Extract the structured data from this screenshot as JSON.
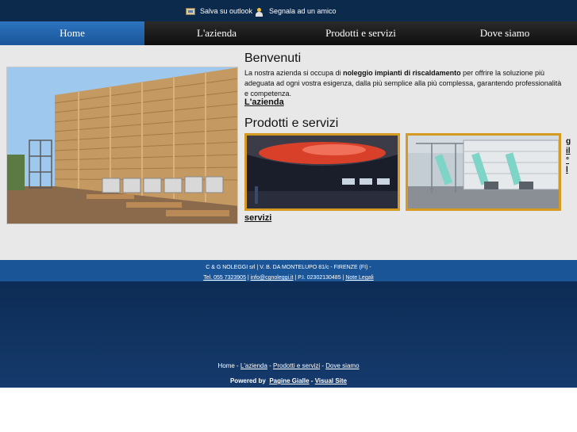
{
  "topbar": {
    "outlook_label": "Salva su outlook",
    "friend_label": "Segnala ad un amico"
  },
  "nav": {
    "items": [
      {
        "label": "Home",
        "active": true
      },
      {
        "label": "L'azienda",
        "active": false
      },
      {
        "label": "Prodotti e servizi",
        "active": false
      },
      {
        "label": "Dove siamo",
        "active": false
      }
    ]
  },
  "welcome": {
    "title": "Benvenuti",
    "text_before": "La nostra azienda si occupa di ",
    "text_bold": "noleggio impianti di riscaldamento",
    "text_after": " per offrire la soluzione più adeguata ad ogni vostra esigenza, dalla più semplice alla più complessa, garantendo professionalità e competenza.",
    "link": "L'azienda"
  },
  "products": {
    "title": "Prodotti e servizi",
    "link": "servizi",
    "edge_fragment": "g\nil\n°\nl"
  },
  "footer": {
    "company": "C & G NOLEGGI srl | V. B. DA MONTELUPO 81/c - FIRENZE (FI) -",
    "phone": "Tel. 055 7323905",
    "email": "info@cgnoleggi.it",
    "vat": "P.I. 02302130485",
    "legal": "Note Legali",
    "sep": " | ",
    "nav": [
      "Home",
      "L'azienda",
      "Prodotti e servizi",
      "Dove siamo"
    ],
    "nav_sep": " - ",
    "powered_label": "Powered by",
    "powered_by": "Pagine Gialle",
    "powered_dash": " - ",
    "visual": "Visual Site"
  },
  "colors": {
    "topbar": "#0c2a4c",
    "nav_active": "#1f63ad",
    "footer_band": "#1a5597",
    "thumb_border": "#d49a22"
  }
}
